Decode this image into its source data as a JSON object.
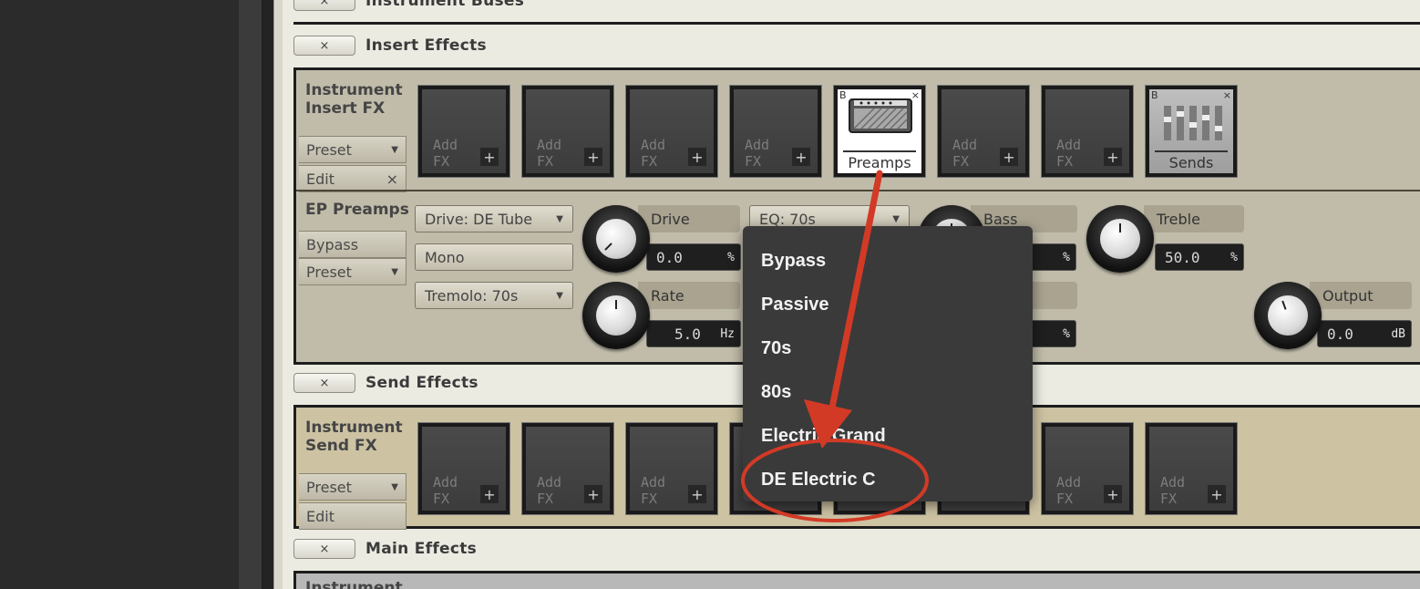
{
  "sections": {
    "instrument_buses": "Instrument Buses",
    "insert_effects": "Insert Effects",
    "send_effects": "Send Effects",
    "main_effects": "Main Effects",
    "close_glyph": "×"
  },
  "insert_panel": {
    "label_line1": "Instrument",
    "label_line2": "Insert FX",
    "preset": "Preset",
    "edit": "Edit",
    "add_fx_line1": "Add",
    "add_fx_line2": "FX",
    "plus": "+",
    "preamps_slot": "Preamps",
    "sends_slot": "Sends",
    "bypass_glyph": "B",
    "close_glyph": "×"
  },
  "ep_preamps": {
    "title": "EP Preamps",
    "bypass": "Bypass",
    "preset": "Preset",
    "drive_select": "Drive: DE Tube",
    "mono": "Mono",
    "tremolo_select": "Tremolo: 70s",
    "eq_select": "EQ: 70s",
    "drive": {
      "label": "Drive",
      "value": "0.0",
      "unit": "%"
    },
    "rate": {
      "label": "Rate",
      "value": "5.0",
      "unit": "Hz"
    },
    "bass": {
      "label": "Bass",
      "value": "",
      "unit": "%"
    },
    "depth": {
      "label": "h",
      "value": "",
      "unit": "%"
    },
    "treble": {
      "label": "Treble",
      "value": "50.0",
      "unit": "%"
    },
    "output": {
      "label": "Output",
      "value": "0.0",
      "unit": "dB"
    }
  },
  "send_panel": {
    "label_line1": "Instrument",
    "label_line2": "Send FX",
    "preset": "Preset",
    "edit": "Edit"
  },
  "main_panel": {
    "label": "Instrument"
  },
  "eq_menu": {
    "items": [
      "Bypass",
      "Passive",
      "70s",
      "80s",
      "Electric Grand",
      "DE Electric C"
    ]
  },
  "annotation_color": "#d23a26"
}
